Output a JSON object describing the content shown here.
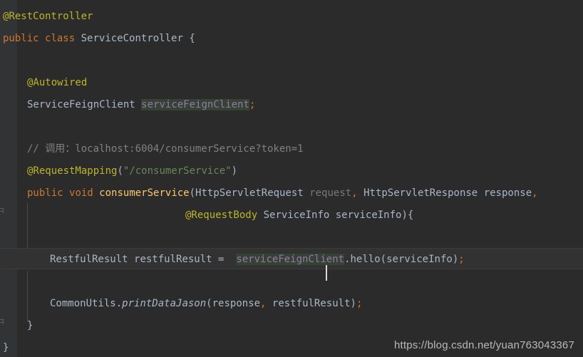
{
  "editor": {
    "background_color": "#2b2b2b",
    "gutter_color": "#313335",
    "caret_line_color": "#323232",
    "selection_color": "#344334",
    "language": "java"
  },
  "colors": {
    "annotation": "#bbb529",
    "keyword": "#cc7832",
    "identifier": "#a9b7c6",
    "field": "#9876aa",
    "comment": "#808080",
    "string": "#6a8759",
    "method": "#ffc66d",
    "unused_param": "#787878"
  },
  "code": {
    "line01_annotation": "@RestController",
    "line02_kw_public": "public",
    "line02_kw_class": "class",
    "line02_classname": "ServiceController",
    "line02_brace": "{",
    "line04_annotation": "@Autowired",
    "line05_type": "ServiceFeignClient",
    "line05_field": "serviceFeignClient",
    "line05_semi": ";",
    "line07_comment": "// 调用：localhost:6004/consumerService?token=1",
    "line08_annotation": "@RequestMapping",
    "line08_paren_open": "(",
    "line08_string": "\"/consumerService\"",
    "line08_paren_close": ")",
    "line09_kw_public": "public",
    "line09_kw_void": "void",
    "line09_method": "consumerService",
    "line09_paren_open": "(",
    "line09_type1": "HttpServletRequest",
    "line09_param1": "request",
    "line09_comma1": ",",
    "line09_type2": "HttpServletResponse",
    "line09_param2": "response",
    "line09_comma2": ",",
    "line10_annotation": "@RequestBody",
    "line10_type": "ServiceInfo",
    "line10_param": "serviceInfo",
    "line10_paren_close": ")",
    "line10_brace": "{",
    "line12_type": "RestfulResult",
    "line12_var": "restfulResult",
    "line12_eq": "=",
    "line12_field_a": "serviceFeignCli",
    "line12_field_b": "ent",
    "line12_dot": ".",
    "line12_call": "hello",
    "line12_paren_open": "(",
    "line12_arg": "serviceInfo",
    "line12_paren_close": ")",
    "line12_semi": ";",
    "line14_class": "CommonUtils",
    "line14_dot": ".",
    "line14_static_method": "printDataJason",
    "line14_paren_open": "(",
    "line14_arg1": "response",
    "line14_comma": ",",
    "line14_arg2": "restfulResult",
    "line14_paren_close": ")",
    "line14_semi": ";",
    "line15_brace": "}",
    "line16_brace": "}"
  },
  "watermark": {
    "url": "https://blog.csdn.net/yuan763043367"
  }
}
